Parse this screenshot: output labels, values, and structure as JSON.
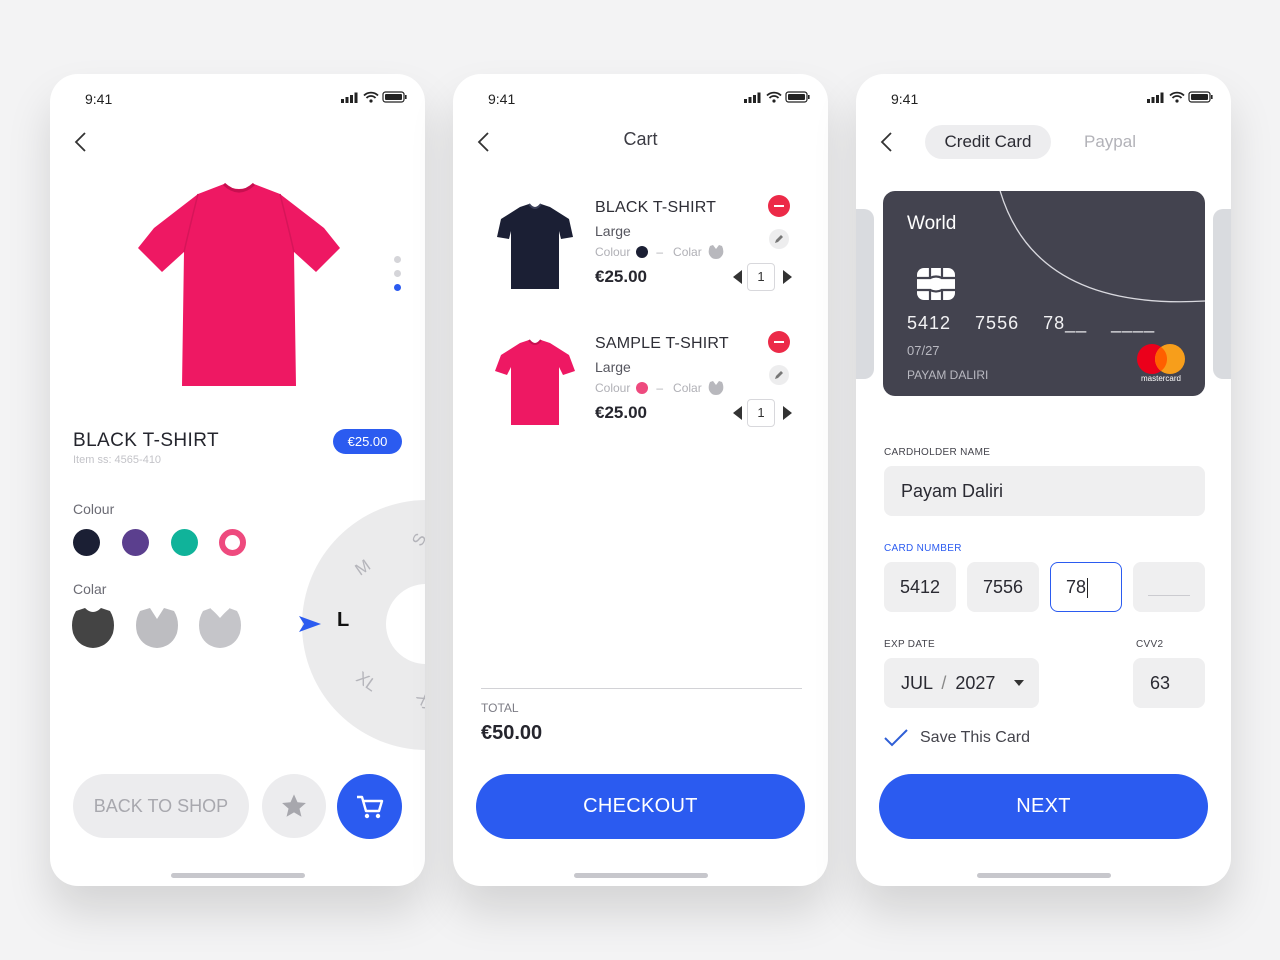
{
  "status_bar": {
    "time": "9:41"
  },
  "colors": {
    "accent": "#2b5bf0",
    "danger": "#ec2a48",
    "card": "#43434f",
    "product_pink": "#ee1863",
    "product_navy": "#1b1f34"
  },
  "product": {
    "title": "BLACK T-SHIRT",
    "sku": "Item ss: 4565-410",
    "price": "€25.00",
    "colour_label": "Colour",
    "collar_label": "Colar",
    "swatches": [
      "#1b1f34",
      "#5b3f8e",
      "#10b39a",
      "#ee4a7e"
    ],
    "sizes": [
      "M",
      "L",
      "XL"
    ],
    "selected_size": "L",
    "back_to_shop": "BACK TO SHOP",
    "icons": [
      "chevron-left-icon",
      "star-icon",
      "cart-icon"
    ]
  },
  "cart": {
    "title": "Cart",
    "items": [
      {
        "name": "BLACK T-SHIRT",
        "size": "Large",
        "colour_label": "Colour",
        "collar_label": "Colar",
        "colour": "#1b1f34",
        "price": "€25.00",
        "qty": "1"
      },
      {
        "name": "SAMPLE T-SHIRT",
        "size": "Large",
        "colour_label": "Colour",
        "collar_label": "Colar",
        "colour": "#ee4a7e",
        "price": "€25.00",
        "qty": "1"
      }
    ],
    "total_label": "TOTAL",
    "total": "€50.00",
    "checkout": "CHECKOUT"
  },
  "payment": {
    "tabs": [
      "Credit Card",
      "Paypal"
    ],
    "card": {
      "bank": "World",
      "number": "5412  7556  78__  ____",
      "expiry": "07/27",
      "holder": "PAYAM DALIRI",
      "brand": "mastercard"
    },
    "cardholder_label": "CARDHOLDER NAME",
    "cardholder_value": "Payam Daliri",
    "card_number_label": "CARD NUMBER",
    "card_number_groups": [
      "5412",
      "7556",
      "78",
      ""
    ],
    "exp_label": "EXP DATE",
    "exp_month": "JUL",
    "exp_sep": "/",
    "exp_year": "2027",
    "cvv_label": "CVV2",
    "cvv_value": "63",
    "save_label": "Save This Card",
    "save_checked": true,
    "next": "NEXT"
  }
}
